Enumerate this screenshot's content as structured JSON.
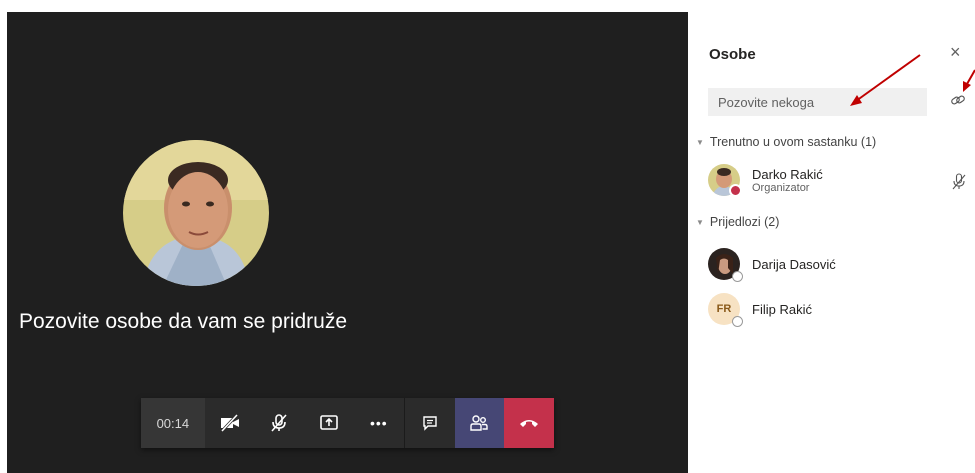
{
  "stage": {
    "invite_message": "Pozovite osobe da vam se pridruže"
  },
  "toolbar": {
    "timer": "00:14",
    "more_label": "•••"
  },
  "panel": {
    "title": "Osobe",
    "close_label": "×",
    "search_placeholder": "Pozovite nekoga",
    "sections": [
      {
        "title": "Trenutno u ovom sastanku (1)",
        "people": [
          {
            "name": "Darko Rakić",
            "role": "Organizator"
          }
        ]
      },
      {
        "title": "Prijedlozi (2)",
        "people": [
          {
            "name": "Darija Dasović"
          },
          {
            "name": "Filip Rakić",
            "initials": "FR"
          }
        ]
      }
    ]
  },
  "colors": {
    "stage_bg": "#1f1f1f",
    "toolbar_bg": "#2b2b2b",
    "people_active": "#464775",
    "hangup": "#c4314b",
    "annotation_arrow": "#c00000"
  },
  "icons": [
    "camera-off-icon",
    "mic-off-icon",
    "share-screen-icon",
    "more-icon",
    "chat-icon",
    "people-icon",
    "hang-up-icon",
    "close-icon",
    "link-icon",
    "muted-mic-icon"
  ]
}
